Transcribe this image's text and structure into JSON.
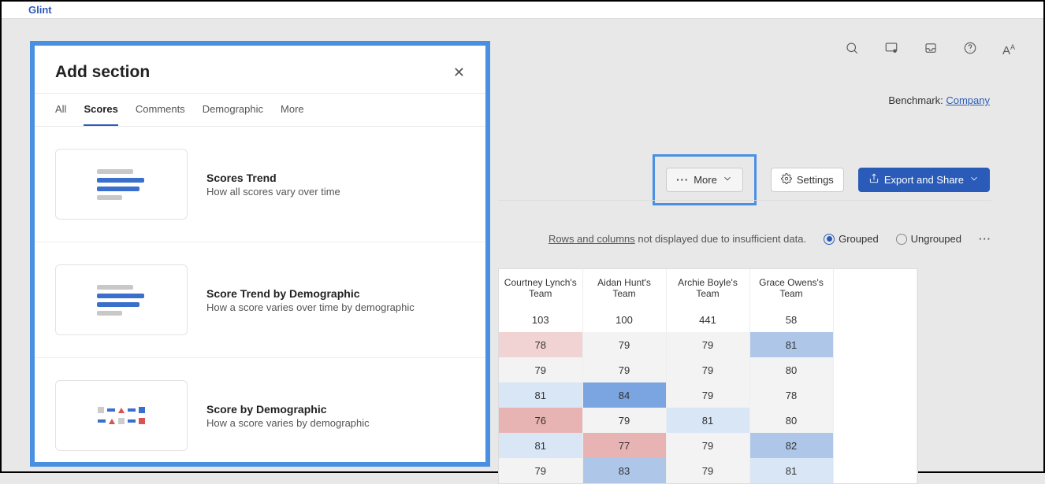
{
  "app": {
    "name": "Glint"
  },
  "benchmark": {
    "label": "Benchmark:",
    "link": "Company"
  },
  "toolbar": {
    "more": "More",
    "settings": "Settings",
    "export": "Export and Share"
  },
  "options": {
    "rows_cols_label": "Rows and columns",
    "insufficient_suffix": " not displayed due to insufficient data.",
    "grouped": "Grouped",
    "ungrouped": "Ungrouped"
  },
  "heatmap": {
    "columns": [
      "Courtney Lynch's Team",
      "Aidan Hunt's Team",
      "Archie Boyle's Team",
      "Grace Owens's Team"
    ],
    "respondents": [
      103,
      100,
      441,
      58
    ],
    "rows": [
      [
        78,
        79,
        79,
        81
      ],
      [
        79,
        79,
        79,
        80
      ],
      [
        81,
        84,
        79,
        78
      ],
      [
        76,
        79,
        81,
        80
      ],
      [
        81,
        77,
        79,
        82
      ],
      [
        79,
        83,
        79,
        81
      ]
    ]
  },
  "modal": {
    "title": "Add section",
    "tabs": [
      "All",
      "Scores",
      "Comments",
      "Demographic",
      "More"
    ],
    "active_tab": "Scores",
    "sections": [
      {
        "title": "Scores Trend",
        "desc": "How all scores vary over time"
      },
      {
        "title": "Score Trend by Demographic",
        "desc": "How a score varies over time by demographic"
      },
      {
        "title": "Score by Demographic",
        "desc": "How a score varies by demographic"
      }
    ]
  }
}
